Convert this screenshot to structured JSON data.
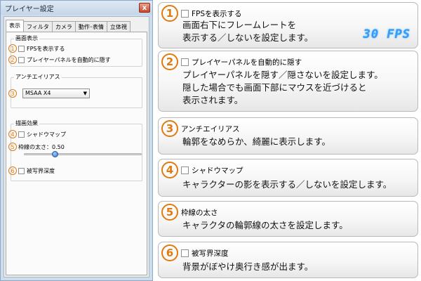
{
  "window": {
    "title": "プレイヤー設定",
    "close_glyph": "x",
    "tabs": [
      "表示",
      "フィルタ",
      "カメラ",
      "動作･表情",
      "立体視"
    ],
    "groups": {
      "display": {
        "title": "画面表示",
        "fps_num": "1",
        "fps_label": "FPSを表示する",
        "panel_num": "2",
        "panel_label": "プレイヤーパネルを自動的に隠す"
      },
      "antialias": {
        "title": "アンチエイリアス",
        "num": "3",
        "selected": "MSAA X4",
        "arrow": "▼"
      },
      "effects": {
        "title": "描画効果",
        "shadow_num": "4",
        "shadow_label": "シャドウマップ",
        "edge_num": "5",
        "edge_label": "枠線の太さ：0.50",
        "edge_value": 0.5,
        "edge_fraction": 0.25,
        "dof_num": "6",
        "dof_label": "被写界深度"
      }
    }
  },
  "cards": [
    {
      "num": "1",
      "label": "FPSを表示する",
      "desc": [
        "画面右下にフレームレートを",
        "表示する／しないを設定します。"
      ],
      "badge": "30 FPS"
    },
    {
      "num": "2",
      "label": "プレイヤーパネルを自動的に隠す",
      "desc": [
        "プレイヤーパネルを隠す／隠さないを設定します。",
        "隠した場合でも画面下部にマウスを近づけると",
        "表示されます。"
      ]
    },
    {
      "num": "3",
      "label": "アンチエイリアス",
      "desc": [
        "輪郭をなめらか、綺麗に表示します。"
      ]
    },
    {
      "num": "4",
      "label": "シャドウマップ",
      "desc": [
        "キャラクターの影を表示する／しないを設定します。"
      ]
    },
    {
      "num": "5",
      "label": "枠線の太さ",
      "desc": [
        "キャラクタの輪郭線の太さを設定します。"
      ]
    },
    {
      "num": "6",
      "label": "被写界深度",
      "desc": [
        "背景がぼやけ奥行き感が出ます。"
      ]
    }
  ],
  "colors": {
    "accent": "#e07a10",
    "fps_badge": "#2f9fff"
  }
}
